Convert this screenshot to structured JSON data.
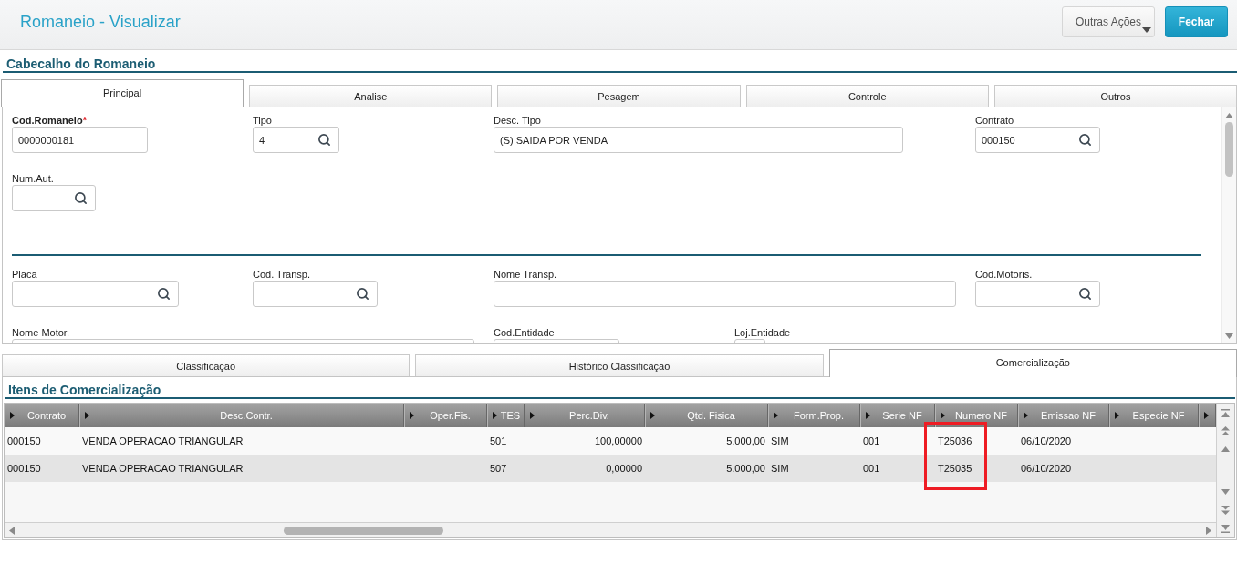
{
  "window": {
    "title": "Romaneio - Visualizar"
  },
  "actions": [
    {
      "label": "Outras Ações",
      "kind": "dropdown"
    },
    {
      "label": "Fechar",
      "kind": "primary"
    }
  ],
  "header_section": {
    "title": "Cabecalho do Romaneio",
    "tabs": [
      {
        "label": "Principal",
        "selected": true
      },
      {
        "label": "Analise",
        "selected": false
      },
      {
        "label": "Pesagem",
        "selected": false
      },
      {
        "label": "Controle",
        "selected": false
      },
      {
        "label": "Outros",
        "selected": false
      }
    ],
    "field_groups": [
      {
        "rows": [
          [
            {
              "label": "Cod.Romaneio",
              "required": true,
              "required_mark": "*",
              "value": "0000000181",
              "lookup": false
            },
            {
              "label": "Tipo",
              "required": false,
              "value": "4",
              "lookup": true
            },
            {
              "label": "Desc. Tipo",
              "required": false,
              "value": "(S) SAIDA POR VENDA",
              "lookup": false
            },
            null,
            {
              "label": "Contrato",
              "required": false,
              "value": "000150",
              "lookup": true
            }
          ],
          [
            {
              "label": "Num.Aut.",
              "required": false,
              "lookup": true
            }
          ]
        ]
      },
      {
        "rows": [
          [
            {
              "label": "Placa",
              "required": false,
              "lookup": true
            },
            {
              "label": "Cod. Transp.",
              "required": false,
              "lookup": true
            },
            {
              "label": "Nome Transp.",
              "required": false,
              "lookup": false
            },
            null,
            {
              "label": "Cod.Motoris.",
              "required": false,
              "lookup": true
            }
          ],
          [
            {
              "label": "Nome Motor.",
              "required": false
            },
            null,
            {
              "label": "Cod.Entidade",
              "required": false
            },
            {
              "label": "Loj.Entidade",
              "required": false
            }
          ]
        ]
      }
    ]
  },
  "detail_tabs": [
    {
      "label": "Classificação",
      "selected": false
    },
    {
      "label": "Histórico Classificação",
      "selected": false
    },
    {
      "label": "Comercialização",
      "selected": true
    }
  ],
  "items_section": {
    "title": "Itens de Comercialização",
    "table": {
      "columns": [
        {
          "label": "Contrato",
          "highlighted": false
        },
        {
          "label": "Desc.Contr.",
          "highlighted": false
        },
        {
          "label": "Oper.Fis.",
          "highlighted": false
        },
        {
          "label": "TES",
          "highlighted": false
        },
        {
          "label": "Perc.Div.",
          "highlighted": false
        },
        {
          "label": "Qtd. Fisica",
          "highlighted": false
        },
        {
          "label": "Form.Prop.",
          "highlighted": false
        },
        {
          "label": "Serie NF",
          "highlighted": false
        },
        {
          "label": "Numero NF",
          "highlighted": true
        },
        {
          "label": "Emissao NF",
          "highlighted": false
        },
        {
          "label": "Especie NF",
          "highlighted": false
        }
      ],
      "rows": [
        {
          "cells": [
            "000150",
            "VENDA OPERACAO TRIANGULAR",
            null,
            "501",
            "100,00000",
            "5.000,00",
            "SIM",
            "001",
            "T25036",
            "06/10/2020",
            null
          ]
        },
        {
          "cells": [
            "000150",
            "VENDA OPERACAO TRIANGULAR",
            null,
            "507",
            "0,00000",
            "5.000,00",
            "SIM",
            "001",
            "T25035",
            "06/10/2020",
            null
          ]
        }
      ]
    }
  }
}
